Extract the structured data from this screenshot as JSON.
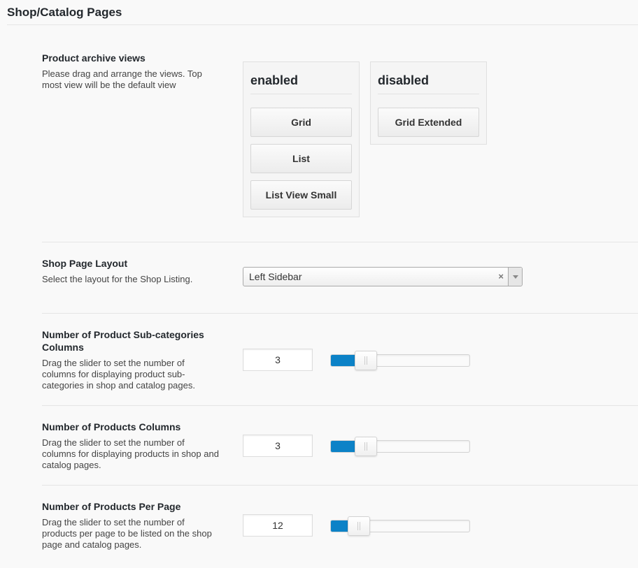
{
  "section": {
    "title": "Shop/Catalog Pages"
  },
  "archive_views": {
    "title": "Product archive views",
    "description": "Please drag and arrange the views. Top most view will be the default view",
    "enabled": {
      "heading": "enabled",
      "items": [
        "Grid",
        "List",
        "List View Small"
      ]
    },
    "disabled": {
      "heading": "disabled",
      "items": [
        "Grid Extended"
      ]
    }
  },
  "shop_layout": {
    "title": "Shop Page Layout",
    "description": "Select the layout for the Shop Listing.",
    "selected": "Left Sidebar",
    "clear_glyph": "×"
  },
  "subcategory_columns": {
    "title": "Number of Product Sub-categories Columns",
    "description": "Drag the slider to set the number of columns for displaying product sub-categories in shop and catalog pages.",
    "value": "3",
    "slider_fraction": 0.25
  },
  "product_columns": {
    "title": "Number of Products Columns",
    "description": "Drag the slider to set the number of columns for displaying products in shop and catalog pages.",
    "value": "3",
    "slider_fraction": 0.25
  },
  "products_per_page": {
    "title": "Number of Products Per Page",
    "description": "Drag the slider to set the number of products per page to be listed on the shop page and catalog pages.",
    "value": "12",
    "slider_fraction": 0.2
  },
  "colors": {
    "accent": "#0c82c7"
  }
}
